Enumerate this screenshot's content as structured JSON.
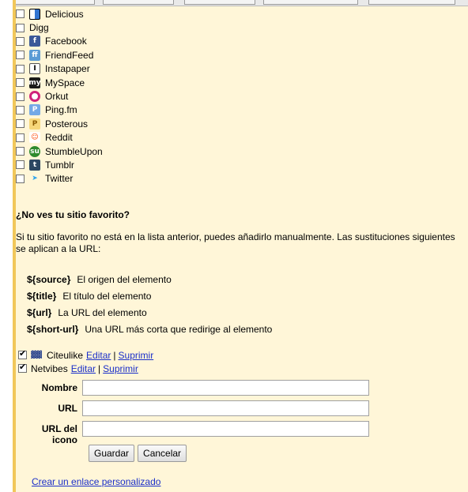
{
  "services": [
    {
      "name": "Delicious",
      "icon": "delicious-icon",
      "checked": false
    },
    {
      "name": "Digg",
      "icon": "",
      "checked": false
    },
    {
      "name": "Facebook",
      "icon": "facebook-icon",
      "checked": false
    },
    {
      "name": "FriendFeed",
      "icon": "friendfeed-icon",
      "checked": false
    },
    {
      "name": "Instapaper",
      "icon": "instapaper-icon",
      "checked": false
    },
    {
      "name": "MySpace",
      "icon": "myspace-icon",
      "checked": false
    },
    {
      "name": "Orkut",
      "icon": "orkut-icon",
      "checked": false
    },
    {
      "name": "Ping.fm",
      "icon": "pingfm-icon",
      "checked": false
    },
    {
      "name": "Posterous",
      "icon": "posterous-icon",
      "checked": false
    },
    {
      "name": "Reddit",
      "icon": "reddit-icon",
      "checked": false
    },
    {
      "name": "StumbleUpon",
      "icon": "stumbleupon-icon",
      "checked": false
    },
    {
      "name": "Tumblr",
      "icon": "tumblr-icon",
      "checked": false
    },
    {
      "name": "Twitter",
      "icon": "twitter-icon",
      "checked": false
    }
  ],
  "favorite_section": {
    "title": "¿No ves tu sitio favorito?",
    "description": "Si tu sitio favorito no está en la lista anterior, puedes añadirlo manualmente. Las sustituciones siguientes se aplican a la URL:"
  },
  "substitutions": [
    {
      "key": "${source}",
      "desc": "El origen del elemento"
    },
    {
      "key": "${title}",
      "desc": "El título del elemento"
    },
    {
      "key": "${url}",
      "desc": "La URL del elemento"
    },
    {
      "key": "${short-url}",
      "desc": "Una URL más corta que redirige al elemento"
    }
  ],
  "custom_services": [
    {
      "name": "Citeulike",
      "icon": "citeulike-icon",
      "checked": true,
      "edit": "Editar",
      "delete": "Suprimir"
    },
    {
      "name": "Netvibes",
      "icon": "",
      "checked": true,
      "edit": "Editar",
      "delete": "Suprimir"
    }
  ],
  "form": {
    "name_label": "Nombre",
    "url_label": "URL",
    "icon_url_label_1": "URL del",
    "icon_url_label_2": "icono",
    "name_value": "",
    "url_value": "",
    "icon_url_value": "",
    "save_label": "Guardar",
    "cancel_label": "Cancelar"
  },
  "create_link_label": "Crear un enlace personalizado",
  "separator": "|",
  "colors": {
    "background": "#fff6d8",
    "border": "#f1c75a",
    "link": "#1a2fc9"
  }
}
